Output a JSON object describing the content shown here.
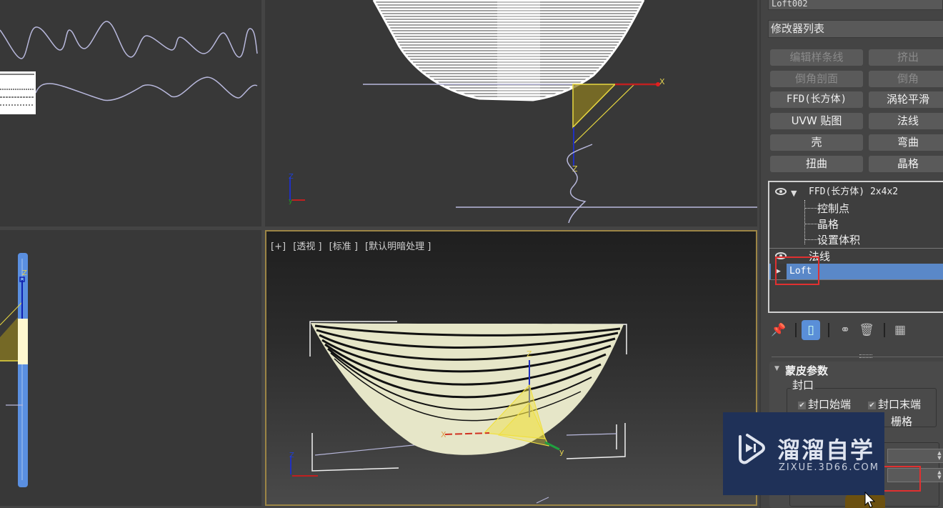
{
  "viewports": {
    "top_left": {
      "name": "front-view"
    },
    "top_right": {
      "name": "left-view",
      "gizmo_labels": {
        "x": "X",
        "z": "Z"
      },
      "axis_labels": {
        "z": "Z",
        "y": "y"
      }
    },
    "bottom_left": {
      "name": "side-view",
      "gizmo_labels": {
        "z": "Z"
      }
    },
    "bottom_right": {
      "labels": [
        "[+]",
        "[透视 ]",
        "[标准 ]",
        "[默认明暗处理 ]"
      ],
      "gizmo_labels": {
        "x": "X",
        "y": "y",
        "z": "Z"
      },
      "axis_labels": {
        "z": "Z"
      },
      "active": true
    }
  },
  "command_panel": {
    "object_name": "Loft002",
    "modifier_list": "修改器列表",
    "modifier_buttons": [
      {
        "label": "编辑样条线",
        "enabled": false
      },
      {
        "label": "挤出",
        "enabled": false
      },
      {
        "label": "倒角剖面",
        "enabled": false
      },
      {
        "label": "倒角",
        "enabled": false
      },
      {
        "label": "FFD(长方体)",
        "enabled": true
      },
      {
        "label": "涡轮平滑",
        "enabled": true
      },
      {
        "label": "UVW 贴图",
        "enabled": true
      },
      {
        "label": "法线",
        "enabled": true
      },
      {
        "label": "壳",
        "enabled": true
      },
      {
        "label": "弯曲",
        "enabled": true
      },
      {
        "label": "扭曲",
        "enabled": true
      },
      {
        "label": "晶格",
        "enabled": true
      }
    ],
    "stack": {
      "ffd": {
        "label": "FFD(长方体) 2x4x2",
        "sub_items": [
          "控制点",
          "晶格",
          "设置体积"
        ]
      },
      "normal": {
        "label": "法线"
      },
      "base": {
        "label": "Loft",
        "selected": true
      }
    },
    "toolbar": {
      "pin": "pin-stack-icon",
      "show_end_result": "show-end-result-icon",
      "make_unique": "make-unique-icon",
      "remove_modifier": "remove-modifier-icon",
      "configure_sets": "configure-modifier-sets-icon"
    },
    "rollout": {
      "title": "蒙皮参数",
      "capping_group": "封口",
      "cap_start": {
        "label": "封口始端",
        "checked": true
      },
      "cap_end": {
        "label": "封口末端",
        "checked": true
      },
      "grid_partial": "栅格"
    }
  },
  "watermark": {
    "title": "溜溜自学",
    "subtitle": "ZIXUE.3D66.COM"
  }
}
